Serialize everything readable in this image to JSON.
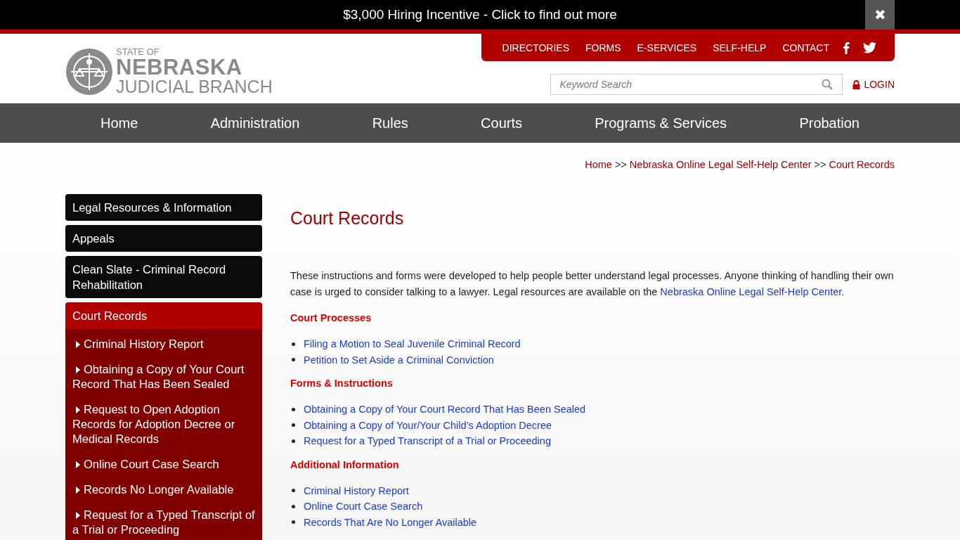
{
  "banner": {
    "text": "$3,000 Hiring Incentive - Click to find out more",
    "close": "✖"
  },
  "logo": {
    "line_1": "STATE OF",
    "line_2": "NEBRASKA",
    "line_3": "JUDICIAL BRANCH"
  },
  "utility_nav": [
    "DIRECTORIES",
    "FORMS",
    "E-SERVICES",
    "SELF-HELP",
    "CONTACT"
  ],
  "search": {
    "placeholder": "Keyword Search"
  },
  "login": "LOGIN",
  "main_nav": [
    "Home",
    "Administration",
    "Rules",
    "Courts",
    "Programs & Services",
    "Probation"
  ],
  "breadcrumb": [
    {
      "kind": "link",
      "text": "Home"
    },
    {
      "kind": "sep",
      "text": ">>"
    },
    {
      "kind": "link",
      "text": "Nebraska Online Legal Self-Help Center"
    },
    {
      "kind": "sep",
      "text": ">>"
    },
    {
      "kind": "link",
      "text": "Court Records"
    }
  ],
  "sidebar": {
    "items": [
      {
        "label": "Legal Resources & Information",
        "selected": false
      },
      {
        "label": "Appeals",
        "selected": false
      },
      {
        "label": "Clean Slate - Criminal Record Rehabilitation",
        "selected": false
      },
      {
        "label": "Court Records",
        "selected": true,
        "children": [
          {
            "label": "Criminal History Report"
          },
          {
            "label": "Obtaining a Copy of Your Court Record That Has Been Sealed"
          },
          {
            "label": "Request to Open Adoption Records for Adoption Decree or Medical Records"
          },
          {
            "label": "Online Court Case Search"
          },
          {
            "label": "Records No Longer Available"
          },
          {
            "label": "Request for a Typed Transcript of a Trial or Proceeding"
          }
        ]
      }
    ]
  },
  "content": {
    "title": "Court Records",
    "intro": "These instructions and forms were developed to help people better understand legal processes. Anyone thinking of handling their own case is urged to consider talking to a lawyer. Legal resources are available on the ",
    "intro_link": "Nebraska Online Legal Self-Help Center",
    "intro_end": ".",
    "sections": [
      {
        "heading": "Court Processes",
        "links": [
          "Filing a Motion to Seal Juvenile Criminal Record",
          "Petition to Set Aside a Criminal Conviction"
        ]
      },
      {
        "heading": "Forms & Instructions",
        "links": [
          "Obtaining a Copy of Your Court Record That Has Been Sealed",
          "Obtaining a Copy of Your/Your Child’s Adoption Decree",
          "Request for a Typed Transcript of a Trial or Proceeding"
        ]
      },
      {
        "heading": "Additional Information",
        "links": [
          "Criminal History Report",
          "Online Court Case Search",
          "Records That Are No Longer Available"
        ]
      }
    ]
  }
}
